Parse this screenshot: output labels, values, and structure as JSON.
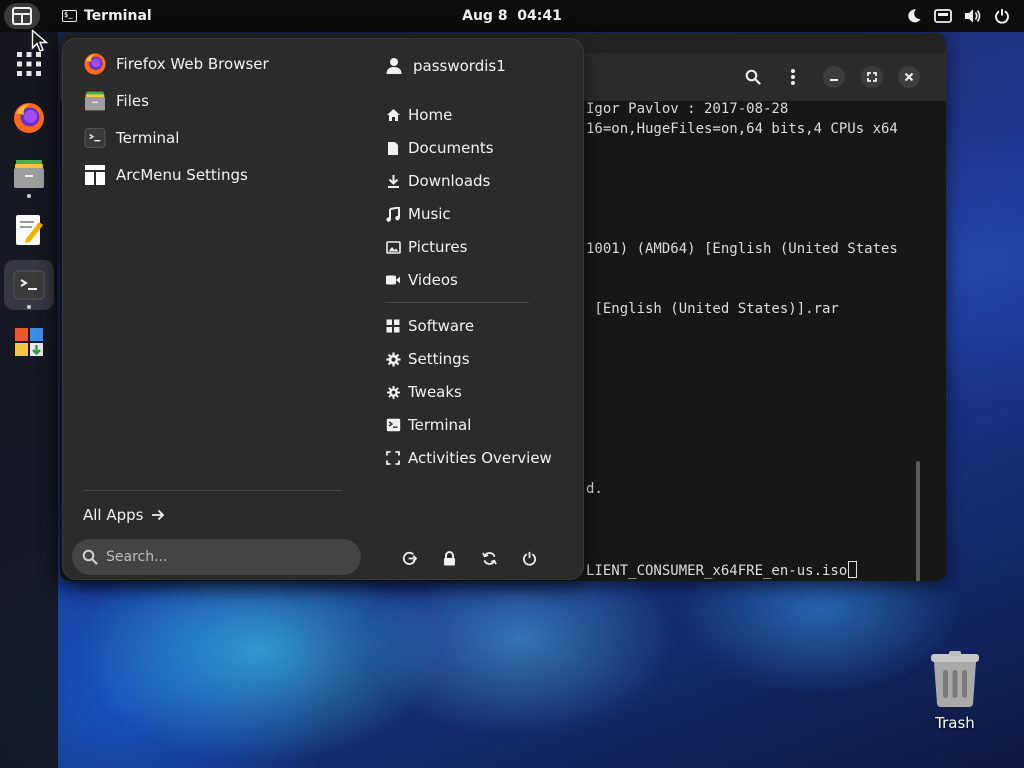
{
  "topbar": {
    "active_app": "Terminal",
    "clock": "Aug 8  04:41"
  },
  "terminal": {
    "lines": [
      "Igor Pavlov : 2017-08-28",
      "16=on,HugeFiles=on,64 bits,4 CPUs x64",
      "1001) (AMD64) [English (United States",
      " [English (United States)].rar",
      "d.",
      "LIENT_CONSUMER_x64FRE_en-us.iso"
    ]
  },
  "arcmenu": {
    "apps": [
      {
        "label": "Firefox Web Browser",
        "icon": "firefox-icon"
      },
      {
        "label": "Files",
        "icon": "files-icon"
      },
      {
        "label": "Terminal",
        "icon": "terminal-icon"
      },
      {
        "label": "ArcMenu Settings",
        "icon": "arcmenu-settings-icon"
      }
    ],
    "user": "passwordis1",
    "places": [
      "Home",
      "Documents",
      "Downloads",
      "Music",
      "Pictures",
      "Videos"
    ],
    "system": [
      "Software",
      "Settings",
      "Tweaks",
      "Terminal",
      "Activities Overview"
    ],
    "all_apps_label": "All Apps",
    "search_placeholder": "Search..."
  },
  "desktop": {
    "trash_label": "Trash"
  },
  "colors": {
    "panel": "#0d0d0d",
    "menu_bg": "#2b2b2b",
    "terminal_bg": "#171717"
  }
}
